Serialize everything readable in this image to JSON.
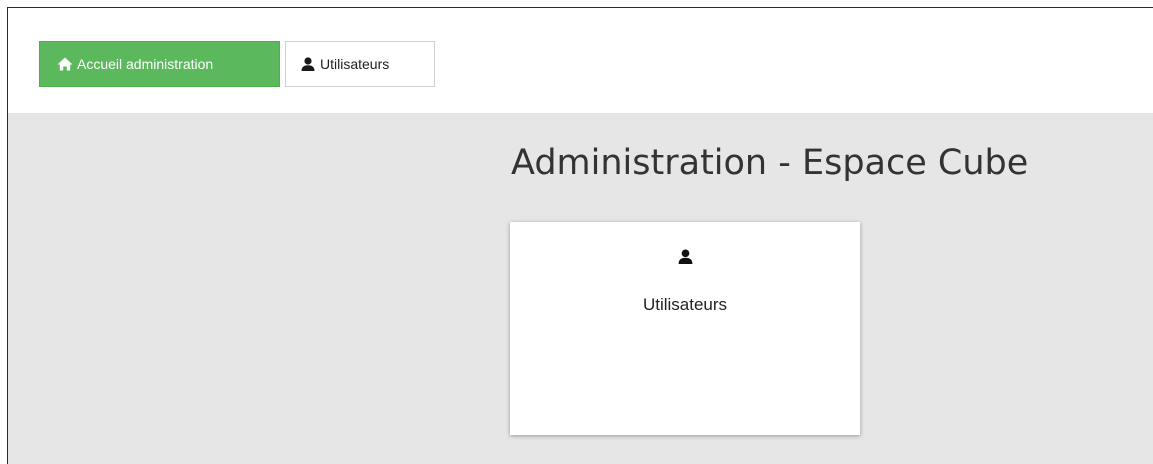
{
  "navbar": {
    "home_button": {
      "label": "Accueil administration",
      "icon": "home-icon",
      "color": "#5cb85c"
    },
    "users_button": {
      "label": "Utilisateurs",
      "icon": "user-icon"
    }
  },
  "main": {
    "title": "Administration - Espace Cube",
    "background": "#e6e6e6",
    "cards": [
      {
        "label": "Utilisateurs",
        "icon": "user-icon"
      }
    ]
  }
}
